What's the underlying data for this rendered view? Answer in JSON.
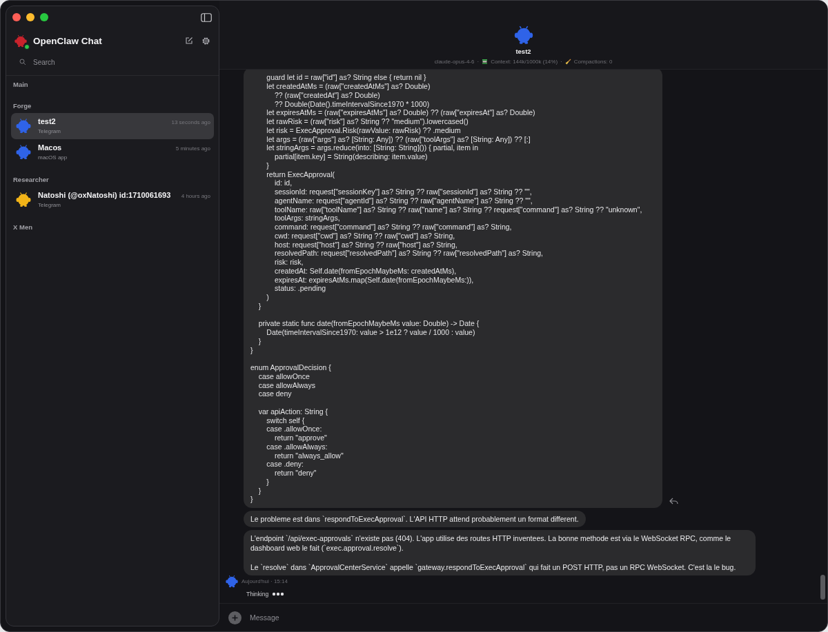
{
  "sidebar": {
    "title": "OpenClaw Chat",
    "online": true,
    "search": {
      "placeholder": "Search"
    },
    "groups": [
      {
        "name": "Main"
      },
      {
        "name": "Forge",
        "chats": [
          {
            "name": "test2",
            "subtitle": "Telegram",
            "time": "13 seconds ago",
            "color": "#2f63e8",
            "selected": true
          },
          {
            "name": "Macos",
            "subtitle": "macOS app",
            "time": "5 minutes ago",
            "color": "#2f63e8",
            "selected": false
          }
        ]
      },
      {
        "name": "Researcher",
        "chats": [
          {
            "name": "Natoshi (@oxNatoshi) id:1710061693",
            "subtitle": "Telegram",
            "time": "4 hours ago",
            "color": "#f2b418",
            "selected": false
          }
        ]
      },
      {
        "name": "X Men"
      }
    ]
  },
  "header": {
    "name": "test2",
    "color": "#2f63e8",
    "meta": [
      {
        "kind": "model",
        "text": "claude-opus-4-6"
      },
      {
        "kind": "separator",
        "text": "·"
      },
      {
        "kind": "context",
        "text": "Context: 144k/1000k (14%)"
      },
      {
        "kind": "separator",
        "text": "·"
      },
      {
        "kind": "compactions",
        "text": "Compactions: 0"
      }
    ]
  },
  "messages": [
    {
      "kind": "code",
      "reply": true,
      "blocks": [
        [
          "        guard let id = raw[\"id\"] as? String else { return nil }",
          "        let createdAtMs = (raw[\"createdAtMs\"] as? Double)",
          "            ?? (raw[\"createdAt\"] as? Double)",
          "            ?? Double(Date().timeIntervalSince1970 * 1000)",
          "        let expiresAtMs = (raw[\"expiresAtMs\"] as? Double) ?? (raw[\"expiresAt\"] as? Double)",
          "        let rawRisk = (raw[\"risk\"] as? String ?? \"medium\").lowercased()",
          "        let risk = ExecApproval.Risk(rawValue: rawRisk) ?? .medium",
          "        let args = (raw[\"args\"] as? [String: Any]) ?? (raw[\"toolArgs\"] as? [String: Any]) ?? [:]",
          "        let stringArgs = args.reduce(into: [String: String]()) { partial, item in",
          "            partial[item.key] = String(describing: item.value)",
          "        }",
          "        return ExecApproval(",
          "            id: id,",
          "            sessionId: request[\"sessionKey\"] as? String ?? raw[\"sessionId\"] as? String ?? \"\",",
          "            agentName: request[\"agentId\"] as? String ?? raw[\"agentName\"] as? String ?? \"\",",
          "            toolName: raw[\"toolName\"] as? String ?? raw[\"name\"] as? String ?? request[\"command\"] as? String ?? \"unknown\",",
          "            toolArgs: stringArgs,",
          "            command: request[\"command\"] as? String ?? raw[\"command\"] as? String,",
          "            cwd: request[\"cwd\"] as? String ?? raw[\"cwd\"] as? String,",
          "            host: request[\"host\"] as? String ?? raw[\"host\"] as? String,",
          "            resolvedPath: request[\"resolvedPath\"] as? String ?? raw[\"resolvedPath\"] as? String,",
          "            risk: risk,",
          "            createdAt: Self.date(fromEpochMaybeMs: createdAtMs),",
          "            expiresAt: expiresAtMs.map(Self.date(fromEpochMaybeMs:)),",
          "            status: .pending",
          "        )",
          "    }"
        ],
        [
          "    private static func date(fromEpochMaybeMs value: Double) -> Date {",
          "        Date(timeIntervalSince1970: value > 1e12 ? value / 1000 : value)",
          "    }",
          "}"
        ],
        [
          "enum ApprovalDecision {",
          "    case allowOnce",
          "    case allowAlways",
          "    case deny"
        ],
        [
          "    var apiAction: String {",
          "        switch self {",
          "        case .allowOnce:",
          "            return \"approve\"",
          "        case .allowAlways:",
          "            return \"always_allow\"",
          "        case .deny:",
          "            return \"deny\"",
          "        }",
          "    }",
          "}"
        ]
      ]
    },
    {
      "kind": "text",
      "paragraphs": [
        "Le probleme est dans `respondToExecApproval`. L'API HTTP attend probablement un format different."
      ]
    },
    {
      "kind": "text",
      "paragraphs": [
        "L'endpoint `/api/exec-approvals` n'existe pas (404). L'app utilise des routes HTTP inventees. La bonne methode est via le WebSocket RPC, comme le dashboard web le fait (`exec.approval.resolve`).",
        "Le `resolve` dans `ApprovalCenterService` appelle `gateway.respondToExecApproval` qui fait un POST HTTP, pas un RPC WebSocket. C'est la le bug."
      ]
    }
  ],
  "timestamp": "Aujourd'hui · 15:14",
  "status": {
    "text": "Thinking",
    "typing": true
  },
  "composer": {
    "placeholder": "Message"
  }
}
